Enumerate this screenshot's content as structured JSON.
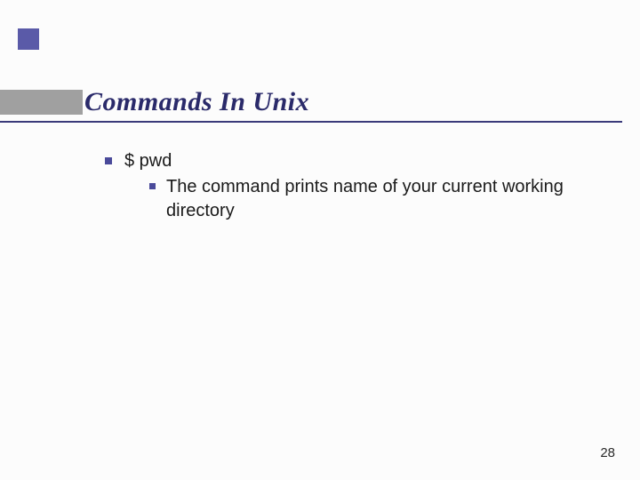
{
  "slide": {
    "title": "Commands In Unix",
    "bullet1": {
      "text": "$ pwd",
      "sub1": "The command prints name of your current working directory"
    },
    "pageNumber": "28"
  }
}
